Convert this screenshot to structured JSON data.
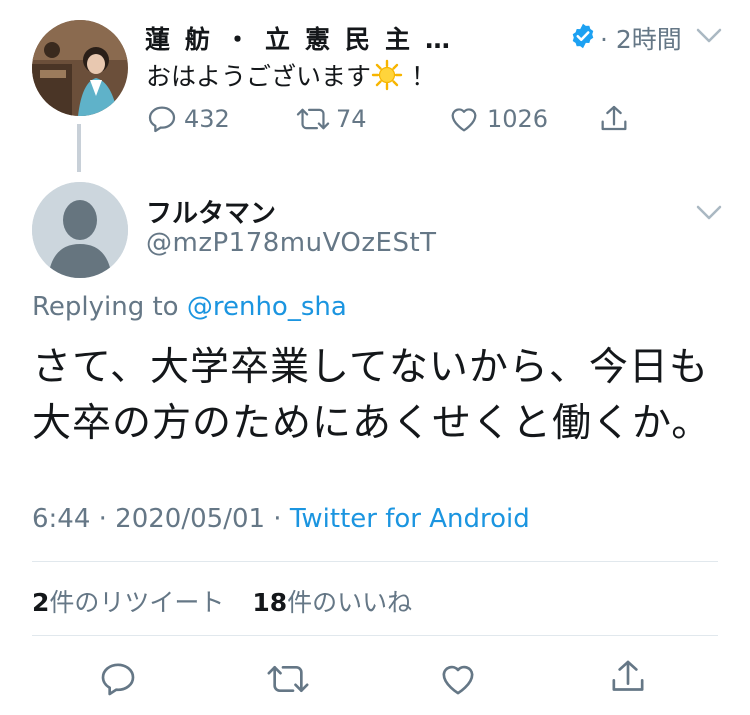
{
  "parent_tweet": {
    "display_name": "蓮舫・立憲民主…",
    "time": "· 2時間",
    "text_before_emoji": "おはようございます",
    "text_after_emoji": " ！",
    "emoji": "sun-emoji",
    "counts": {
      "replies": "432",
      "retweets": "74",
      "likes": "1026"
    }
  },
  "reply_tweet": {
    "display_name": "フルタマン",
    "handle": "@mzP178muVOzEStT",
    "replying_label": "Replying to ",
    "replying_handle": "@renho_sha",
    "text": "さて、大学卒業してないから、今日も大卒の方のためにあくせくと働くか。",
    "timestamp": "6:44 · 2020/05/01 · ",
    "source": "Twitter for Android",
    "retweet_count": "2",
    "retweet_label": "件のリツイート",
    "like_count": "18",
    "like_label": "件のいいね"
  },
  "colors": {
    "link": "#1b95e0",
    "secondary": "#657786",
    "verified": "#1da1f2",
    "divider": "#e1e8ed"
  }
}
